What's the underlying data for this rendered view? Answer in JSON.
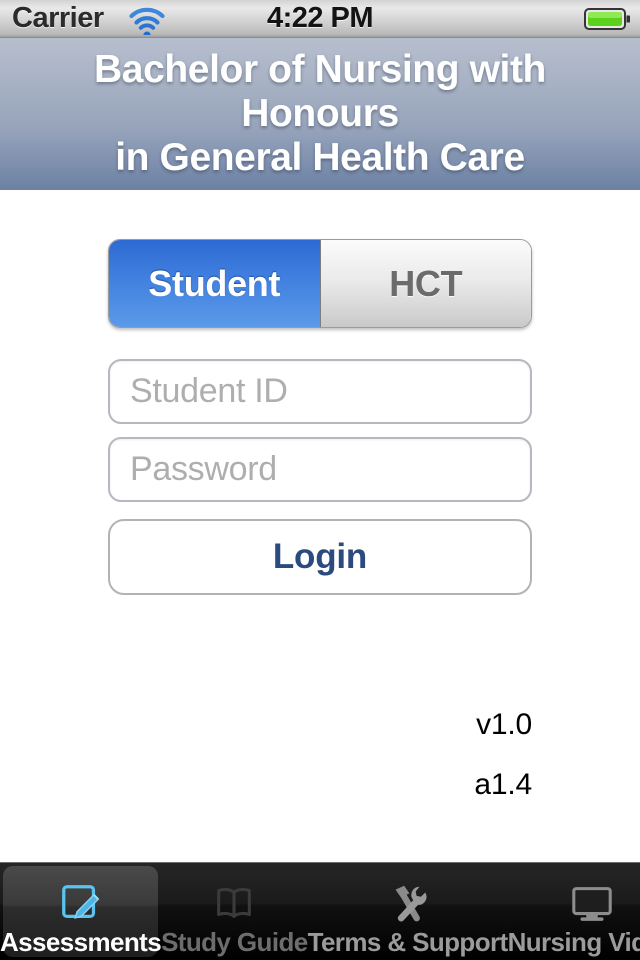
{
  "status_bar": {
    "carrier": "Carrier",
    "time": "4:22 PM",
    "wifi_icon": "wifi-icon",
    "battery_icon": "battery-icon",
    "battery_color": "#5cd11c"
  },
  "header": {
    "title": "Bachelor of Nursing with Honours\nin General Health Care",
    "gradient_top": "#b7bece",
    "gradient_bottom": "#6b80a2"
  },
  "segmented_control": {
    "segments": [
      {
        "label": "Student",
        "selected": true
      },
      {
        "label": "HCT",
        "selected": false
      }
    ],
    "selected_color": "#3f7ede"
  },
  "form": {
    "student_id": {
      "placeholder": "Student ID",
      "value": ""
    },
    "password": {
      "placeholder": "Password",
      "value": ""
    },
    "login_label": "Login",
    "login_text_color": "#2b4a7e"
  },
  "version": {
    "app": "v1.0",
    "asset": "a1.4"
  },
  "tab_bar": {
    "tabs": [
      {
        "label": "Assessments",
        "icon": "compose-pencil-icon",
        "active": true
      },
      {
        "label": "Study Guide",
        "icon": "open-book-icon",
        "active": false
      },
      {
        "label": "Terms & Support",
        "icon": "hammer-wrench-icon",
        "active": false
      },
      {
        "label": "Nursing Video",
        "icon": "monitor-tv-icon",
        "active": false
      }
    ],
    "active_icon_color": "#5bc3f0"
  }
}
